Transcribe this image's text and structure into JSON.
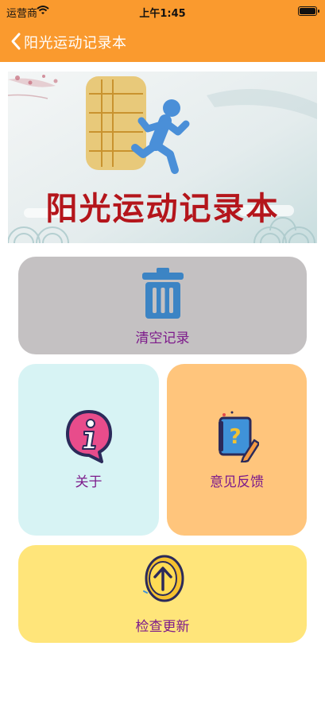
{
  "status_bar": {
    "carrier": "运营商",
    "time": "上午1:45"
  },
  "nav": {
    "title": "阳光运动记录本"
  },
  "banner": {
    "title": "阳光运动记录本"
  },
  "menu": {
    "clear_label": "清空记录",
    "about_label": "关于",
    "feedback_label": "意见反馈",
    "update_label": "检查更新"
  },
  "icons": {
    "back": "chevron-left-icon",
    "clear": "trash-icon",
    "about": "info-icon",
    "feedback": "question-notebook-icon",
    "update": "arrow-up-circle-icon",
    "banner": "running-person-icon"
  },
  "colors": {
    "header": "#fa9a2e",
    "clear_card": "#c4c1c2",
    "about_card": "#d7f3f4",
    "feedback_card": "#ffc57c",
    "update_card": "#ffe57a",
    "label": "#7d1b8b",
    "banner_title": "#b4151b"
  }
}
